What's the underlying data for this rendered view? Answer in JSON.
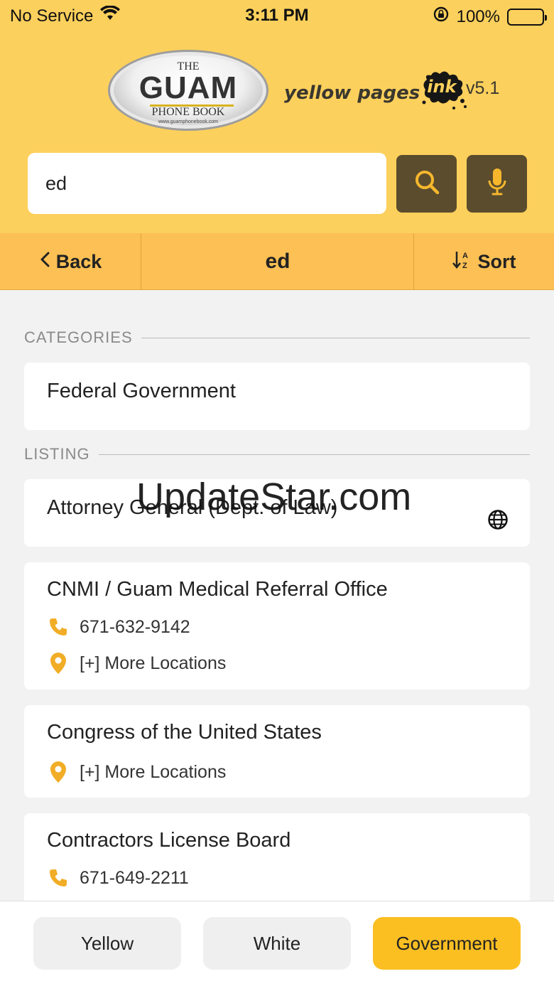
{
  "status_bar": {
    "carrier": "No Service",
    "time": "3:11 PM",
    "battery": "100%"
  },
  "header": {
    "logo": {
      "the": "THE",
      "main": "GUAM",
      "sub": "PHONE BOOK",
      "url": "www.guamphonebook.com"
    },
    "brand_text": "yellow pages",
    "brand_ink": "ink",
    "version": "v5.1"
  },
  "search": {
    "value": "ed",
    "search_icon": "search-icon",
    "mic_icon": "microphone-icon"
  },
  "navbar": {
    "back_label": "Back",
    "title": "ed",
    "sort_label": "Sort"
  },
  "sections": {
    "categories_label": "CATEGORIES",
    "listing_label": "LISTING"
  },
  "categories": [
    {
      "name": "Federal Government"
    }
  ],
  "listings": [
    {
      "name": "Attorney General (Dept. of Law)"
    },
    {
      "name": "CNMI / Guam Medical Referral Office",
      "phone": "671-632-9142",
      "locations": "[+] More Locations"
    },
    {
      "name": "Congress of the United States",
      "locations": "[+] More Locations"
    },
    {
      "name": "Contractors License Board",
      "phone": "671-649-2211"
    }
  ],
  "watermark": "UpdateStar.com",
  "tabs": {
    "yellow": "Yellow",
    "white": "White",
    "government": "Government"
  },
  "colors": {
    "header": "#fcd05c",
    "navbar": "#fcc054",
    "button_dark": "#5a4c2d",
    "accent_icon": "#f2ad27",
    "tab_active": "#fbbf22"
  }
}
